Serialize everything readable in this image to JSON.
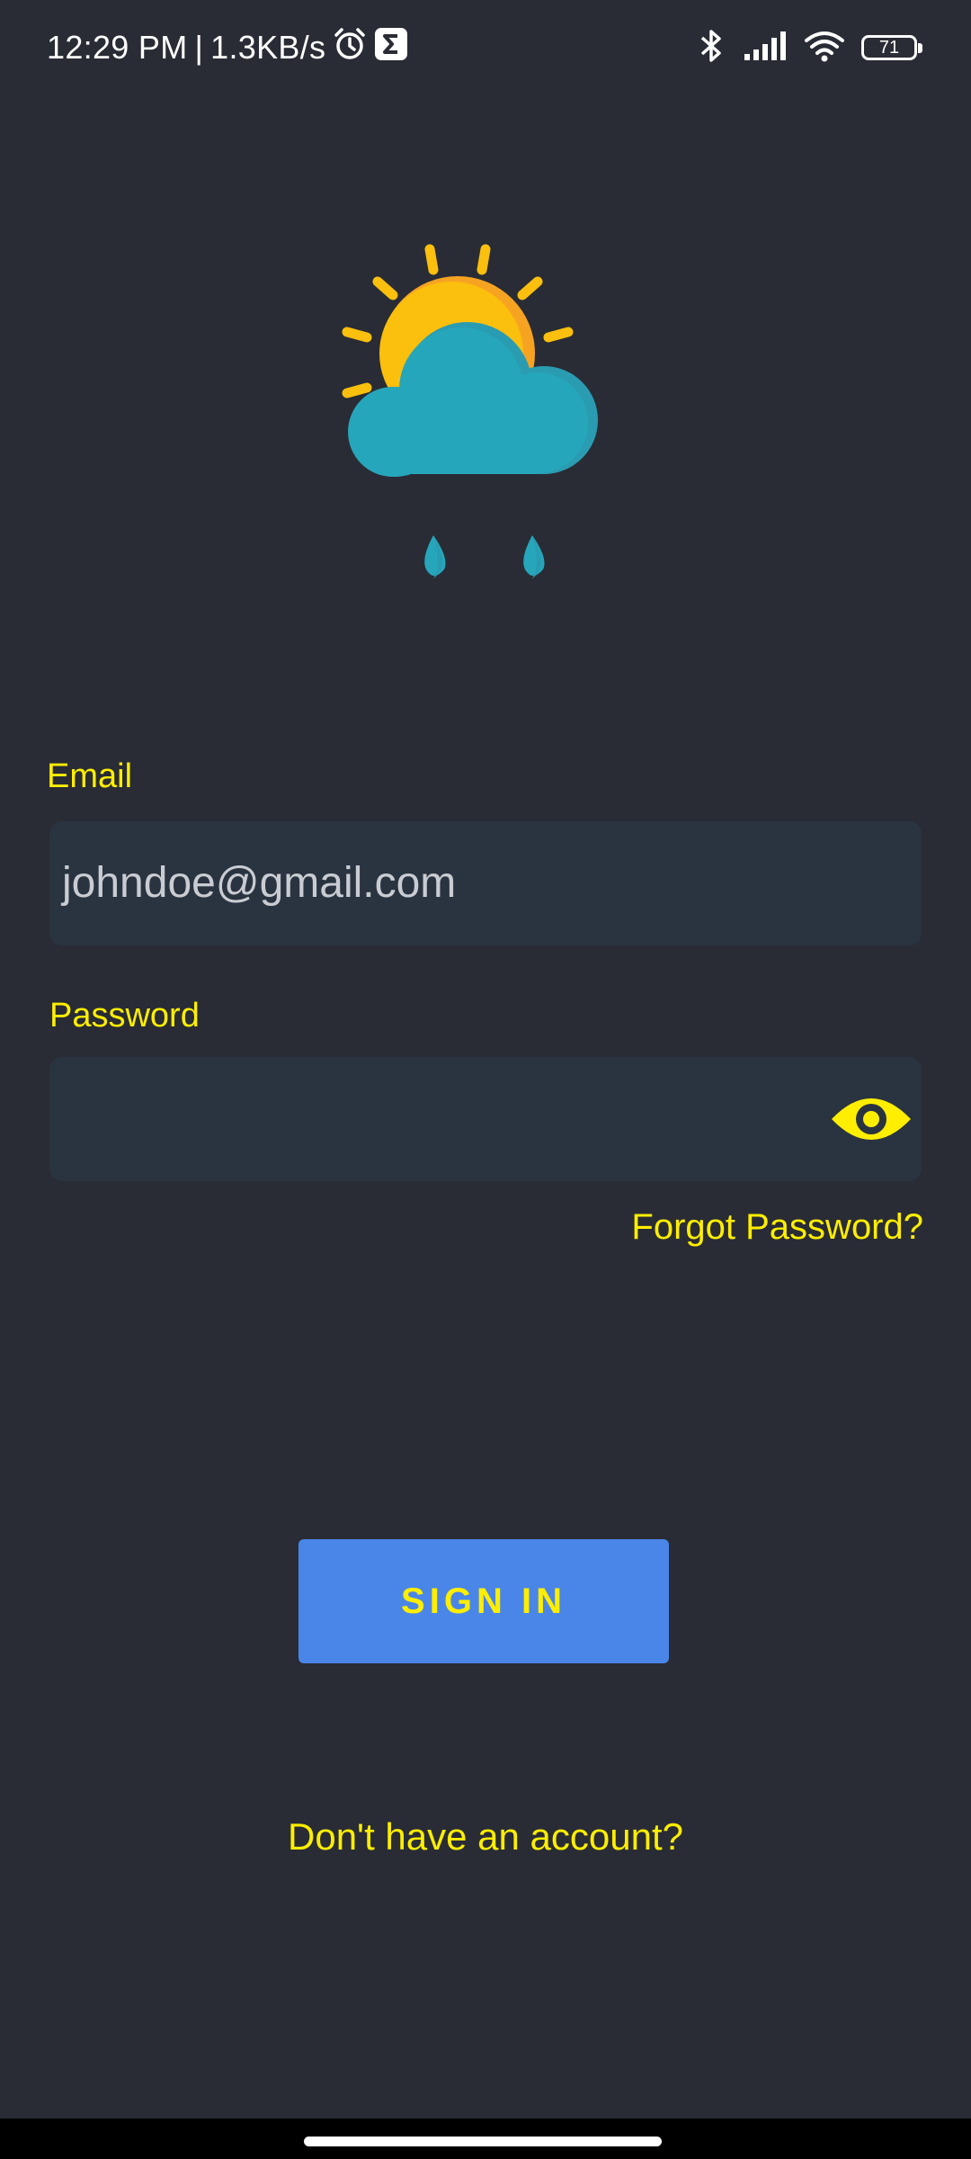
{
  "status_bar": {
    "time": "12:29 PM",
    "separator": "|",
    "network_speed": "1.3KB/s",
    "battery_level": "71",
    "icons": [
      "alarm-icon",
      "sigma-notification-icon",
      "bluetooth-icon",
      "signal-icon",
      "wifi-icon",
      "battery-icon"
    ]
  },
  "logo": {
    "icon": "weather-sun-cloud-rain-icon"
  },
  "form": {
    "email_label": "Email",
    "email_value": "johndoe@gmail.com",
    "password_label": "Password",
    "password_value": "",
    "password_toggle_icon": "eye-icon",
    "forgot_password": "Forgot Password?",
    "sign_in": "SIGN IN",
    "no_account": "Don't have an account?"
  },
  "colors": {
    "background": "#292c35",
    "field_background": "#2a3440",
    "accent_text": "#ffee00",
    "button": "#4a86e8"
  }
}
